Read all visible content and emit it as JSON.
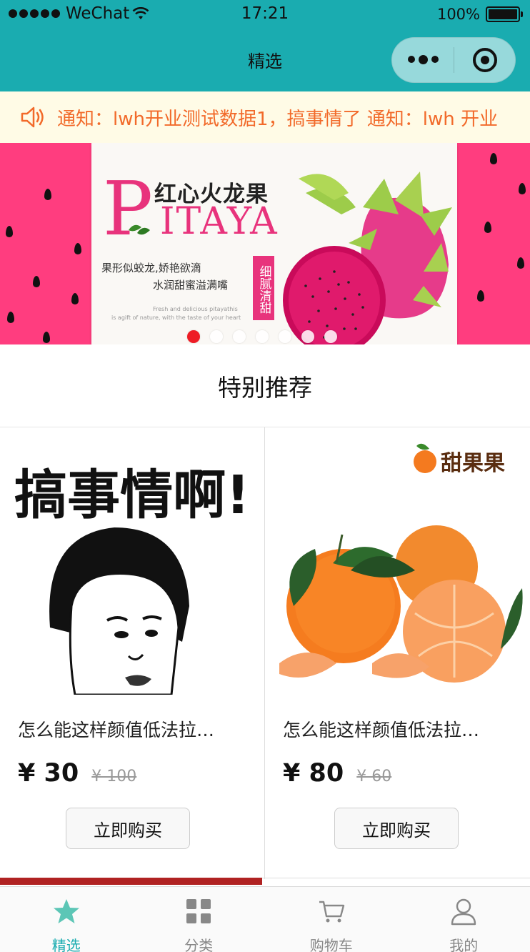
{
  "status_bar": {
    "carrier": "WeChat",
    "time": "17:21",
    "battery": "100%"
  },
  "nav": {
    "title": "精选"
  },
  "notice": {
    "icon": "speaker-icon",
    "text": "通知：lwh开业测试数据1，搞事情了  通知：lwh 开业"
  },
  "banner": {
    "title_cn": "红心火龙果",
    "title_p": "P",
    "title_en": "ITAYA",
    "line1": "果形似蛟龙,娇艳欲滴",
    "line2": "水润甜蜜溢满嘴",
    "small1": "Fresh and delicious pitayathis",
    "small2": "is agift of nature, with the taste of your heart",
    "tag": "细腻清甜",
    "slides": 7,
    "active_slide": 1
  },
  "section": {
    "title": "特别推荐"
  },
  "products": [
    {
      "name": "怎么能这样颜值低法拉…",
      "price": "¥ 30",
      "old_price": "¥ 100",
      "buy_label": "立即购买",
      "image_text": "搞事情啊!"
    },
    {
      "name": "怎么能这样颜值低法拉…",
      "price": "¥ 80",
      "old_price": "¥ 60",
      "buy_label": "立即购买",
      "brand": "甜果果"
    }
  ],
  "tabbar": {
    "items": [
      {
        "label": "精选",
        "icon": "star-icon",
        "active": true
      },
      {
        "label": "分类",
        "icon": "grid-icon",
        "active": false
      },
      {
        "label": "购物车",
        "icon": "cart-icon",
        "active": false
      },
      {
        "label": "我的",
        "icon": "user-icon",
        "active": false
      }
    ]
  },
  "colors": {
    "accent": "#1aacb0",
    "notice_text": "#f26a2a",
    "notice_bg": "#fffbe6",
    "pitaya_pink": "#e8337c",
    "melon_pink": "#ff3d7f",
    "dot_active": "#ee1c25"
  }
}
